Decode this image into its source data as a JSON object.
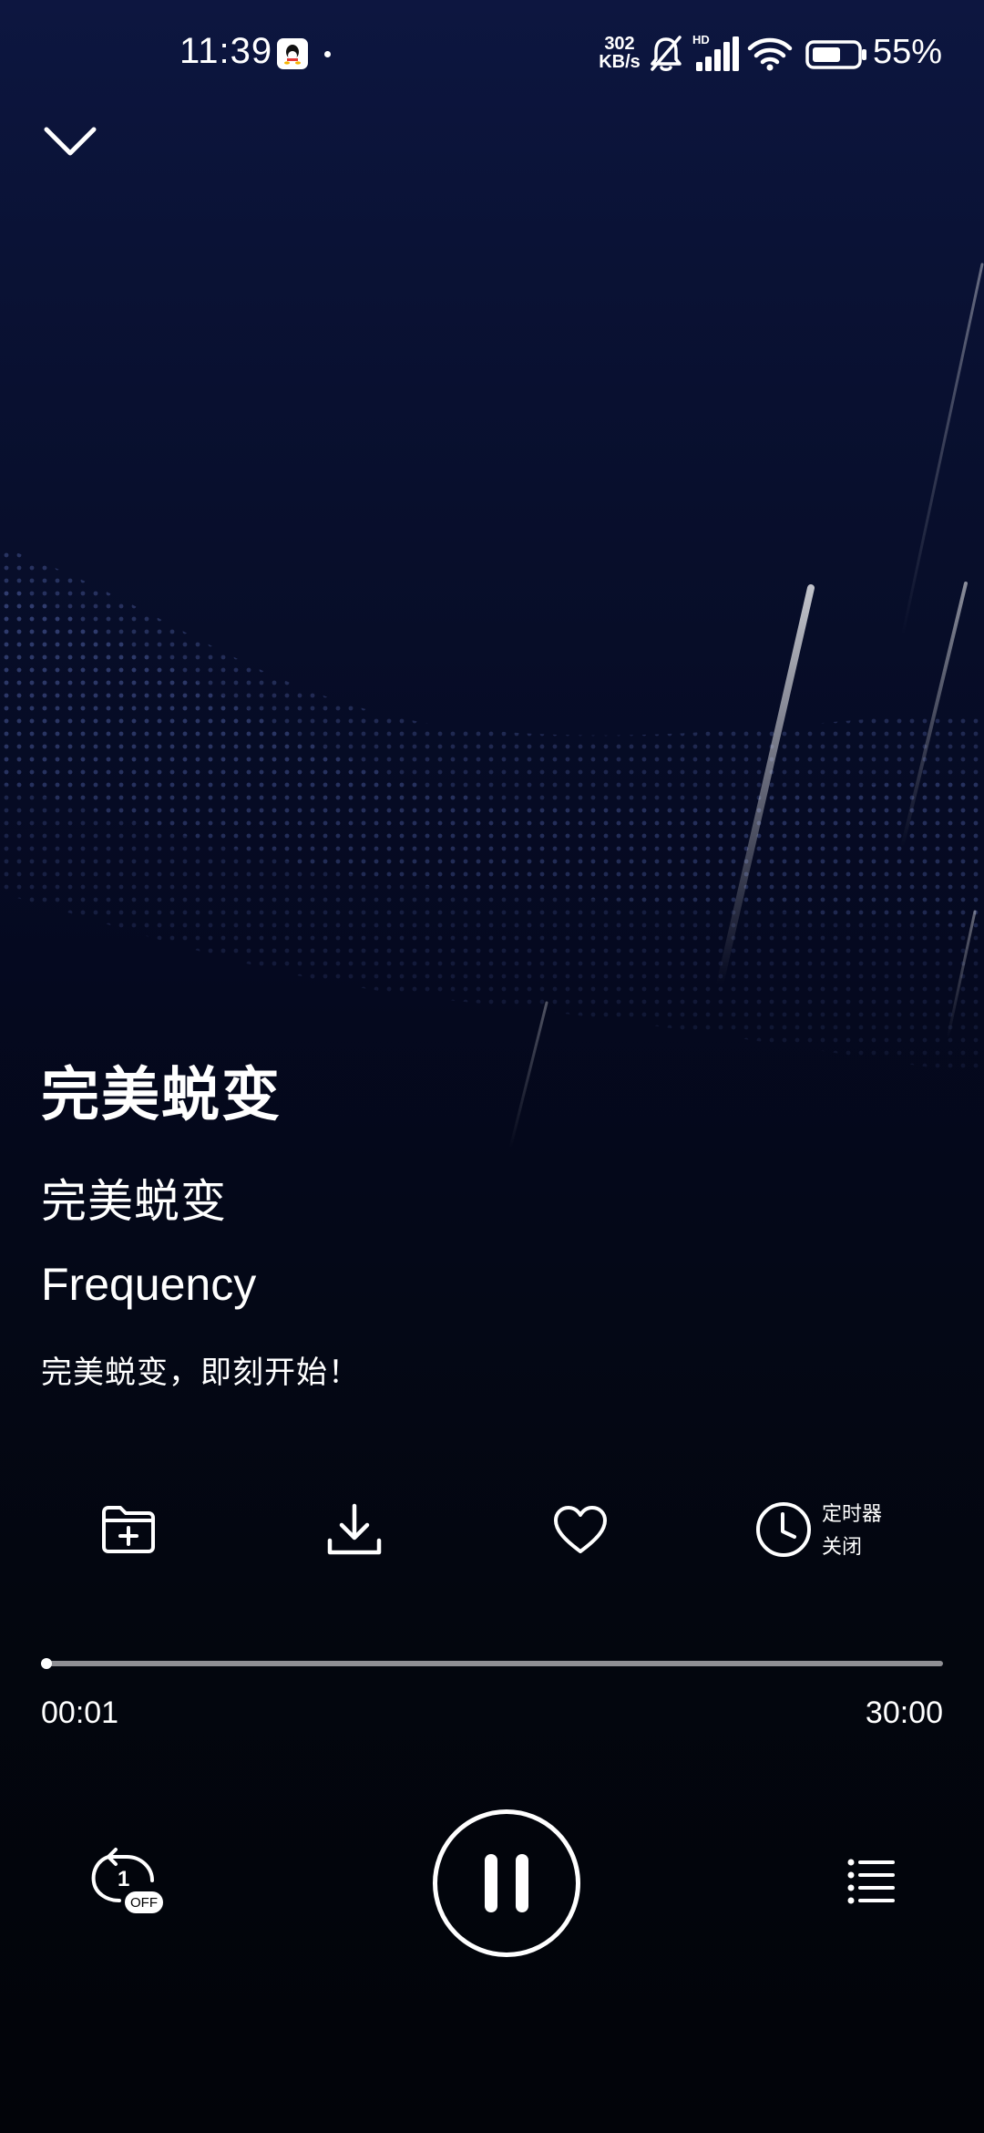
{
  "status_bar": {
    "time": "11:39",
    "net_speed_value": "302",
    "net_speed_unit": "KB/s",
    "signal_label": "HD",
    "battery_percent": "55%",
    "icons": [
      "qq-icon",
      "mute-bell-icon",
      "signal-icon",
      "wifi-icon",
      "battery-icon"
    ]
  },
  "header": {
    "collapse_icon": "chevron-down-icon"
  },
  "track": {
    "title": "完美蜕变",
    "album": "完美蜕变",
    "artist": "Frequency",
    "description": "完美蜕变，即刻开始！"
  },
  "actions": {
    "add_to_folder_icon": "folder-add-icon",
    "download_icon": "download-icon",
    "favorite_icon": "heart-icon",
    "timer_icon": "clock-icon",
    "timer_label": "定时器",
    "timer_status": "关闭"
  },
  "progress": {
    "current_time": "00:01",
    "total_time": "30:00",
    "fraction": 0.0006
  },
  "controls": {
    "repeat_count": "1",
    "repeat_state": "OFF",
    "play_state": "pause",
    "playlist_icon": "playlist-icon"
  },
  "colors": {
    "background_top": "#0d1640",
    "background_bottom": "#020409",
    "foreground": "#ffffff",
    "track_inactive": "#8f8f94"
  }
}
